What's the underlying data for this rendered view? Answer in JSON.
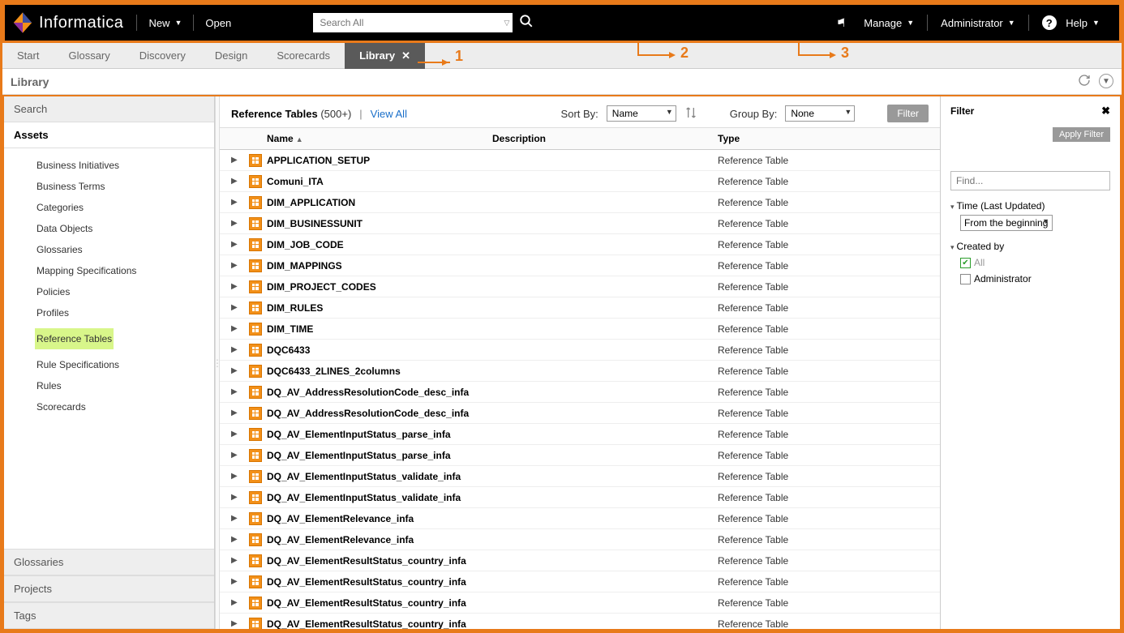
{
  "brand": "Informatica",
  "header": {
    "new_label": "New",
    "open_label": "Open",
    "search_placeholder": "Search All",
    "manage_label": "Manage",
    "admin_label": "Administrator",
    "help_label": "Help"
  },
  "annotations": {
    "a1": "1",
    "a2": "2",
    "a3": "3"
  },
  "tabs": [
    {
      "label": "Start"
    },
    {
      "label": "Glossary"
    },
    {
      "label": "Discovery"
    },
    {
      "label": "Design"
    },
    {
      "label": "Scorecards"
    },
    {
      "label": "Library"
    }
  ],
  "page_title": "Library",
  "left": {
    "sections": {
      "search": "Search",
      "assets": "Assets",
      "glossaries": "Glossaries",
      "projects": "Projects",
      "tags": "Tags"
    },
    "asset_items": [
      "Business Initiatives",
      "Business Terms",
      "Categories",
      "Data Objects",
      "Glossaries",
      "Mapping Specifications",
      "Policies",
      "Profiles",
      "Reference Tables",
      "Rule Specifications",
      "Rules",
      "Scorecards"
    ],
    "selected_index": 8
  },
  "center": {
    "heading_prefix": "Reference Tables",
    "heading_count": "(500+)",
    "view_all": "View All",
    "sort_by_label": "Sort By:",
    "sort_by_value": "Name",
    "group_by_label": "Group By:",
    "group_by_value": "None",
    "filter_btn": "Filter",
    "columns": {
      "name": "Name",
      "desc": "Description",
      "type": "Type"
    },
    "type_value": "Reference Table",
    "rows": [
      "APPLICATION_SETUP",
      "Comuni_ITA",
      "DIM_APPLICATION",
      "DIM_BUSINESSUNIT",
      "DIM_JOB_CODE",
      "DIM_MAPPINGS",
      "DIM_PROJECT_CODES",
      "DIM_RULES",
      "DIM_TIME",
      "DQC6433",
      "DQC6433_2LINES_2columns",
      "DQ_AV_AddressResolutionCode_desc_infa",
      "DQ_AV_AddressResolutionCode_desc_infa",
      "DQ_AV_ElementInputStatus_parse_infa",
      "DQ_AV_ElementInputStatus_parse_infa",
      "DQ_AV_ElementInputStatus_validate_infa",
      "DQ_AV_ElementInputStatus_validate_infa",
      "DQ_AV_ElementRelevance_infa",
      "DQ_AV_ElementRelevance_infa",
      "DQ_AV_ElementResultStatus_country_infa",
      "DQ_AV_ElementResultStatus_country_infa",
      "DQ_AV_ElementResultStatus_country_infa",
      "DQ_AV_ElementResultStatus_country_infa"
    ]
  },
  "filter": {
    "title": "Filter",
    "apply": "Apply Filter",
    "find_placeholder": "Find...",
    "time_label": "Time (Last Updated)",
    "time_value": "From the beginning",
    "created_by_label": "Created by",
    "all_label": "All",
    "admin_label": "Administrator"
  }
}
